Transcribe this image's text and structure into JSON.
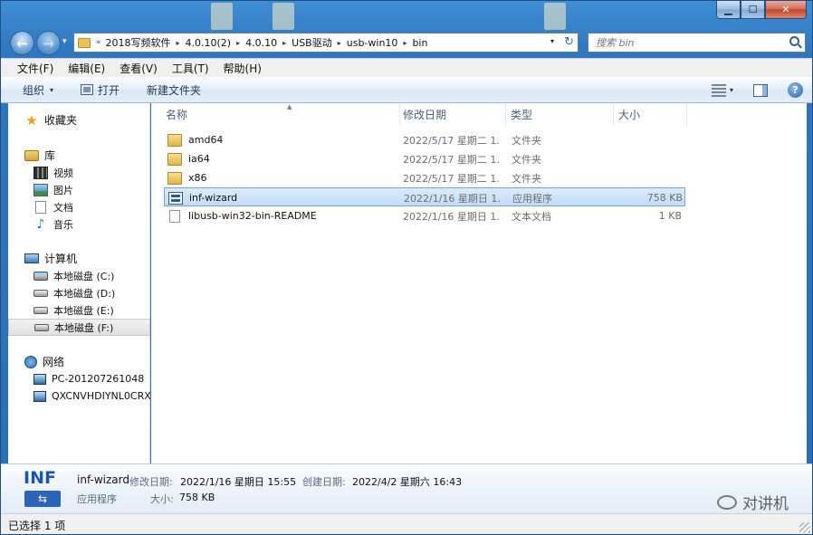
{
  "window": {
    "caption_buttons": {
      "minimize": "▁",
      "maximize": "☐",
      "close": "✕"
    }
  },
  "nav": {
    "back_glyph": "←",
    "forward_glyph": "→",
    "history_glyph": "▾"
  },
  "address": {
    "overflow": "«",
    "breadcrumbs": [
      "2018写频软件",
      "4.0.10(2)",
      "4.0.10",
      "USB驱动",
      "usb-win10",
      "bin"
    ],
    "separator": "▸",
    "dropdown_glyph": "▾",
    "refresh_glyph": "↻"
  },
  "search": {
    "placeholder": "搜索 bin",
    "icon": "search-icon"
  },
  "menu": {
    "items": [
      "文件(F)",
      "编辑(E)",
      "查看(V)",
      "工具(T)",
      "帮助(H)"
    ]
  },
  "toolbar": {
    "organize": "组织",
    "open": "打开",
    "new_folder": "新建文件夹",
    "caret": "▾",
    "help_glyph": "?"
  },
  "sidebar": {
    "favorites": "收藏夹",
    "libraries": "库",
    "library_items": [
      "视频",
      "图片",
      "文档",
      "音乐"
    ],
    "computer": "计算机",
    "drives": [
      "本地磁盘 (C:)",
      "本地磁盘 (D:)",
      "本地磁盘 (E:)",
      "本地磁盘 (F:)"
    ],
    "network": "网络",
    "network_items": [
      "PC-201207261048",
      "QXCNVHDIYNL0CRX"
    ],
    "star_glyph": "★",
    "music_glyph": "♪"
  },
  "columns": {
    "name": "名称",
    "date": "修改日期",
    "type": "类型",
    "size": "大小",
    "sort_glyph": "▲"
  },
  "files": [
    {
      "name": "amd64",
      "date": "2022/5/17 星期二 1...",
      "type": "文件夹",
      "size": "",
      "icon": "folder"
    },
    {
      "name": "ia64",
      "date": "2022/5/17 星期二 1...",
      "type": "文件夹",
      "size": "",
      "icon": "folder"
    },
    {
      "name": "x86",
      "date": "2022/5/17 星期二 1...",
      "type": "文件夹",
      "size": "",
      "icon": "folder"
    },
    {
      "name": "inf-wizard",
      "date": "2022/1/16 星期日 1...",
      "type": "应用程序",
      "size": "758 KB",
      "icon": "app"
    },
    {
      "name": "libusb-win32-bin-README",
      "date": "2022/1/16 星期日 1...",
      "type": "文本文档",
      "size": "1 KB",
      "icon": "text"
    }
  ],
  "details": {
    "icon_label": "INF",
    "usb_glyph": "⇆",
    "name": "inf-wizard",
    "modified_label": "修改日期:",
    "modified": "2022/1/16 星期日 15:55",
    "created_label": "创建日期:",
    "created": "2022/4/2 星期六 16:43",
    "type": "应用程序",
    "size_label": "大小:",
    "size": "758 KB"
  },
  "watermark": "对讲机",
  "status": "已选择 1 项",
  "colors": {
    "chrome_blue": "#2e76bd",
    "selection": "#c2dcf7",
    "selection_border": "#7da2ce"
  }
}
